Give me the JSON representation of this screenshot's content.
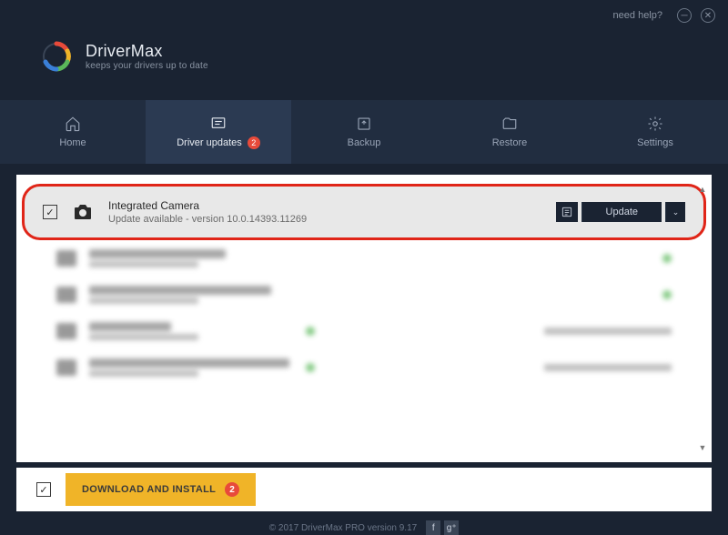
{
  "titlebar": {
    "help": "need help?"
  },
  "header": {
    "app_name": "DriverMax",
    "tagline": "keeps your drivers up to date"
  },
  "nav": {
    "items": [
      {
        "label": "Home"
      },
      {
        "label": "Driver updates",
        "badge": "2"
      },
      {
        "label": "Backup"
      },
      {
        "label": "Restore"
      },
      {
        "label": "Settings"
      }
    ]
  },
  "driver": {
    "title": "Integrated Camera",
    "subtitle": "Update available - version 10.0.14393.11269",
    "update_label": "Update"
  },
  "install": {
    "label": "DOWNLOAD AND INSTALL",
    "badge": "2"
  },
  "footer": {
    "copyright": "© 2017 DriverMax PRO version 9.17"
  }
}
